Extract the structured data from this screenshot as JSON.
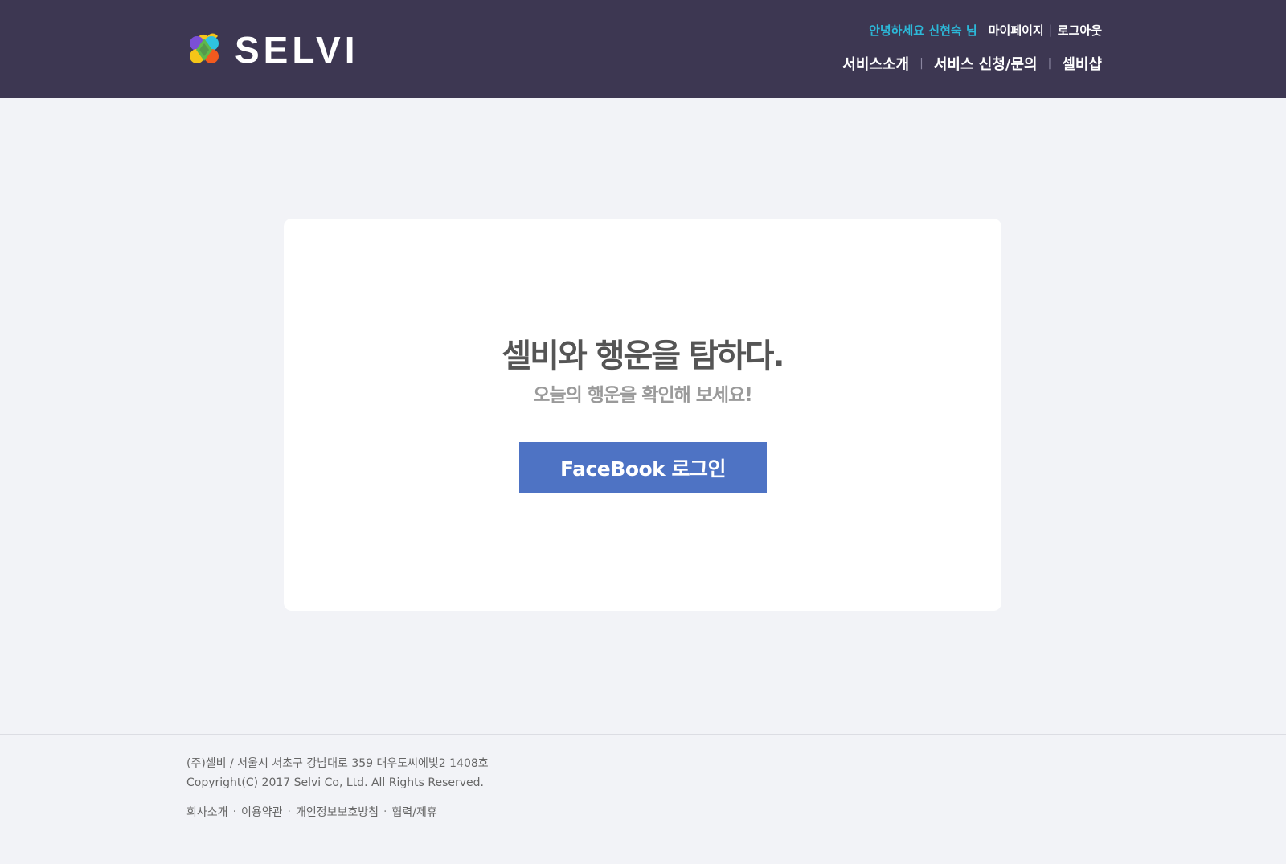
{
  "brand": {
    "name": "SELVI"
  },
  "header": {
    "greeting": "안녕하세요 신현숙 님",
    "mypage": "마이페이지",
    "logout": "로그아웃",
    "util_separator": "|",
    "nav": {
      "intro": "서비스소개",
      "apply": "서비스 신청/문의",
      "shop": "셀비샵",
      "separator": "|"
    }
  },
  "main": {
    "headline": "셀비와 행운을 탐하다.",
    "subline": "오늘의 행운을 확인해 보세요!",
    "login_button": "FaceBook 로그인"
  },
  "footer": {
    "address": "(주)셀비 / 서울시 서초구 강남대로 359 대우도씨에빛2 1408호",
    "copyright": "Copyright(C) 2017 Selvi Co, Ltd. All Rights Reserved.",
    "links": {
      "about": "회사소개",
      "terms": "이용약관",
      "privacy": "개인정보보호방침",
      "partnership": "협력/제휴",
      "dot": "·"
    }
  },
  "colors": {
    "header_bg": "#3d3752",
    "page_bg": "#f2f3f7",
    "greeting": "#2cb8d8",
    "facebook_button": "#4e73c4"
  },
  "icons": {
    "logo": "heart-clover-logo-icon"
  }
}
